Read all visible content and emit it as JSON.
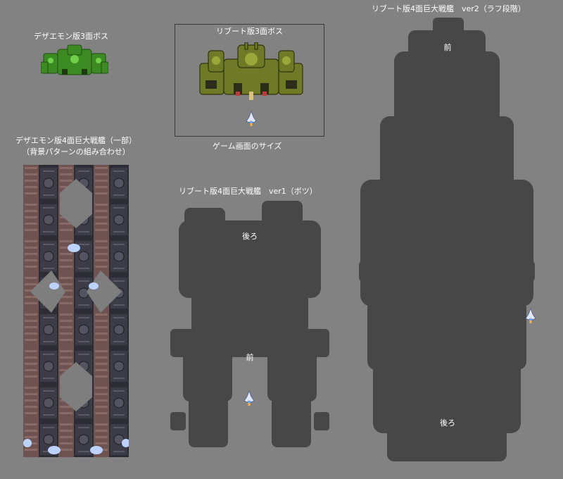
{
  "labels": {
    "dezaemon_stage3_boss": "デザエモン版3面ボス",
    "reboot_stage3_boss": "リブート版3面ボス",
    "game_screen_size": "ゲーム画面のサイズ",
    "dezaemon_battleship_line1": "デザエモン版4面巨大戦艦（一部）",
    "dezaemon_battleship_line2": "（背景パターンの組み合わせ）",
    "reboot_battleship_v1": "リブート版4面巨大戦艦　ver1（ボツ）",
    "reboot_battleship_v2": "リブート版4面巨大戦艦　ver2（ラフ段階）"
  },
  "silhouette_labels": {
    "v1_rear": "後ろ",
    "v1_front": "前",
    "v2_front": "前",
    "v2_rear": "後ろ"
  },
  "colors": {
    "background": "#828282",
    "silhouette": "#474747",
    "boss_green": "#3c8a22",
    "boss_olive": "#6f7a26",
    "hull_brown": "#6e5350",
    "hull_dark": "#2c2c34"
  },
  "sprites": {
    "player_ship": "player-ship-sprite",
    "dezaemon_boss": "green-boss-sprite",
    "reboot_boss": "olive-boss-sprite"
  }
}
